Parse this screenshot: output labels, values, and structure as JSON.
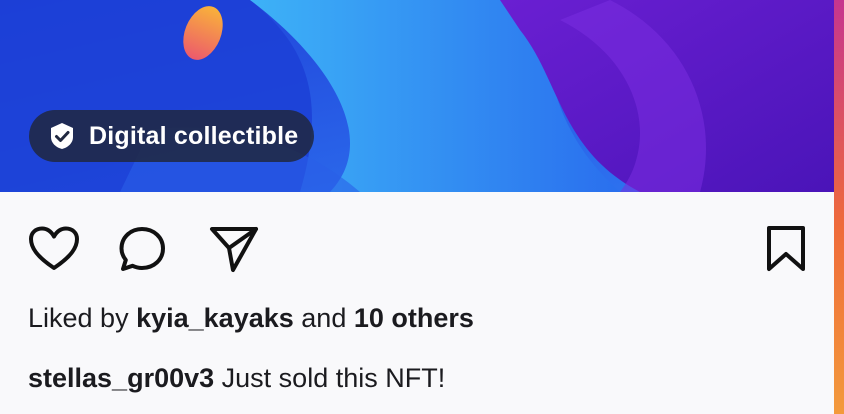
{
  "colors": {
    "frame_accent": "#e2504f",
    "badge_bg": "#202840",
    "text": "#1b1b1f",
    "post_bg": "#f9f9fb"
  },
  "media": {
    "badge": {
      "icon": "verified-check-icon",
      "label": "Digital collectible"
    }
  },
  "actions": {
    "like": {
      "icon": "heart-icon"
    },
    "comment": {
      "icon": "comment-icon"
    },
    "share": {
      "icon": "paper-plane-icon"
    },
    "save": {
      "icon": "bookmark-icon"
    }
  },
  "likes": {
    "prefix": "Liked by",
    "user": "kyia_kayaks",
    "joiner": "and",
    "others": "10 others"
  },
  "caption": {
    "username": "stellas_gr00v3",
    "text": "Just sold this NFT!"
  }
}
